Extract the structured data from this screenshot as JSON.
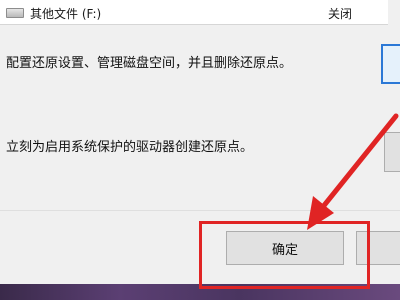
{
  "drive_list": {
    "drive_name": "其他文件 (F:)",
    "drive_status": "关闭",
    "drive_icon": "hard-drive-icon"
  },
  "config_description": "配置还原设置、管理磁盘空间，并且删除还原点。",
  "create_description": "立刻为启用系统保护的驱动器创建还原点。",
  "buttons": {
    "ok_label": "确定"
  },
  "annotation": {
    "arrow_color": "#e02424",
    "box_color": "#e02424"
  }
}
